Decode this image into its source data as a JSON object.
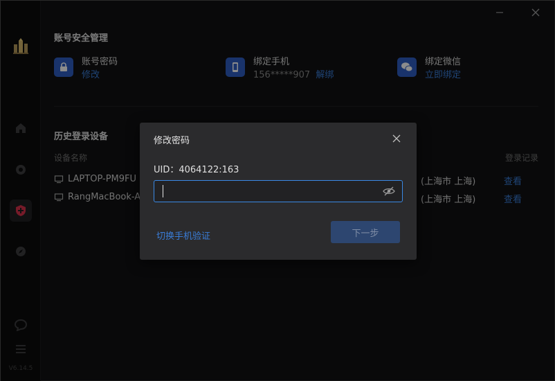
{
  "app": {
    "version": "V6.14.5",
    "accent": "#2f5ec4",
    "link_color": "#3a7dd8"
  },
  "sidebar": {
    "items": [
      {
        "icon": "app-logo-icon"
      },
      {
        "icon": "home-icon"
      },
      {
        "icon": "game-controller-icon"
      },
      {
        "icon": "shield-icon",
        "active": true
      },
      {
        "icon": "compass-icon"
      },
      {
        "icon": "chat-bubble-icon"
      },
      {
        "icon": "menu-icon"
      }
    ]
  },
  "account_security": {
    "title": "账号安全管理",
    "items": [
      {
        "icon": "lock-icon",
        "title": "账号密码",
        "value": "",
        "action": "修改"
      },
      {
        "icon": "phone-icon",
        "title": "绑定手机",
        "value": "156*****907",
        "action": "解绑"
      },
      {
        "icon": "wechat-icon",
        "title": "绑定微信",
        "value": "",
        "action": "立即绑定"
      }
    ]
  },
  "login_history": {
    "title": "历史登录设备",
    "columns": {
      "device": "设备名称",
      "record": "登录记录"
    },
    "rows": [
      {
        "device": "LAPTOP-PM9FU",
        "location": "(上海市 上海)",
        "action": "查看"
      },
      {
        "device": "RangMacBook-A",
        "location": "(上海市 上海)",
        "action": "查看"
      }
    ]
  },
  "dialog": {
    "title": "修改密码",
    "uid_label": "UID：4064122:163",
    "password_value": "",
    "switch_link": "切换手机验证",
    "next_button": "下一步"
  }
}
